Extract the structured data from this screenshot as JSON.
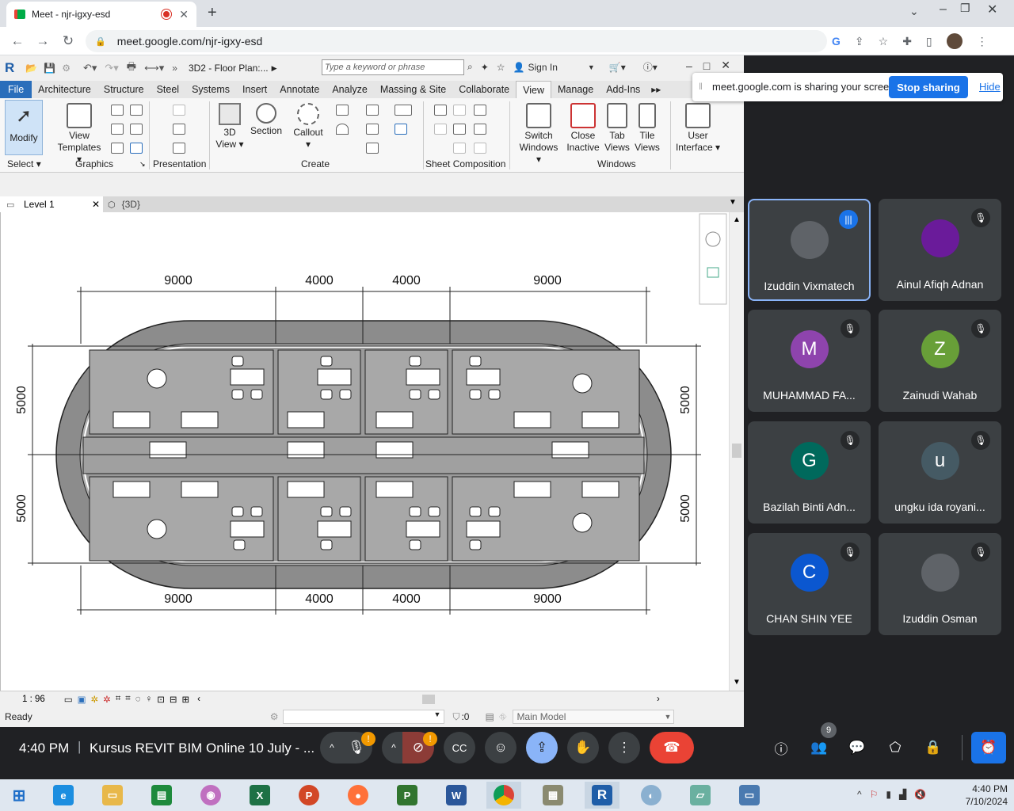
{
  "browser": {
    "tab_title": "Meet - njr-igxy-esd",
    "url": "meet.google.com/njr-igxy-esd"
  },
  "revit": {
    "title": "3D2 - Floor Plan:...",
    "search_placeholder": "Type a keyword or phrase",
    "sign_in": "Sign In",
    "tabs": [
      "File",
      "Architecture",
      "Structure",
      "Steel",
      "Systems",
      "Insert",
      "Annotate",
      "Analyze",
      "Massing & Site",
      "Collaborate",
      "View",
      "Manage",
      "Add-Ins"
    ],
    "active_tab": "View",
    "buttons": {
      "modify": "Modify",
      "view_templates_1": "View",
      "view_templates_2": "Templates",
      "view_3d_1": "3D",
      "view_3d_2": "View",
      "section": "Section",
      "callout": "Callout",
      "switch_windows_1": "Switch",
      "switch_windows_2": "Windows",
      "close_inactive_1": "Close",
      "close_inactive_2": "Inactive",
      "tab_views_1": "Tab",
      "tab_views_2": "Views",
      "tile_views_1": "Tile",
      "tile_views_2": "Views",
      "user_interface_1": "User",
      "user_interface_2": "Interface"
    },
    "groups": {
      "select": "Select",
      "graphics": "Graphics",
      "presentation": "Presentation",
      "create": "Create",
      "sheet_composition": "Sheet Composition",
      "windows": "Windows"
    },
    "view_tabs": [
      "Level 1",
      "{3D}"
    ],
    "scale": "1 : 96",
    "status": "Ready",
    "selection_count": ":0",
    "workset": "Main Model",
    "plan": {
      "top_dims": [
        "9000",
        "4000",
        "4000",
        "9000"
      ],
      "bottom_dims": [
        "9000",
        "4000",
        "4000",
        "9000"
      ],
      "left_dims": [
        "5000",
        "5000"
      ],
      "right_dims": [
        "5000",
        "5000"
      ]
    }
  },
  "share_banner": {
    "message": "meet.google.com is sharing your screen.",
    "stop": "Stop sharing",
    "hide": "Hide"
  },
  "participants": [
    {
      "name": "Izuddin Vixmatech",
      "initial": "",
      "color": "#5f6368",
      "speaking": true
    },
    {
      "name": "Ainul Afiqh Adnan",
      "initial": "",
      "color": "#6a1b9a",
      "speaking": false
    },
    {
      "name": "MUHAMMAD FA...",
      "initial": "M",
      "color": "#8e44ad",
      "speaking": false
    },
    {
      "name": "Zainudi Wahab",
      "initial": "Z",
      "color": "#689f38",
      "speaking": false
    },
    {
      "name": "Bazilah Binti Adn...",
      "initial": "G",
      "color": "#00695c",
      "speaking": false
    },
    {
      "name": "ungku ida royani...",
      "initial": "u",
      "color": "#455a64",
      "speaking": false
    },
    {
      "name": "CHAN SHIN YEE",
      "initial": "C",
      "color": "#0b57d0",
      "speaking": false
    },
    {
      "name": "Izuddin Osman",
      "initial": "",
      "color": "#5f6368",
      "speaking": false
    }
  ],
  "meeting": {
    "time": "4:40 PM",
    "title": "Kursus REVIT BIM Online 10 July - ...",
    "people_count": "9"
  },
  "taskbar": {
    "time": "4:40 PM",
    "date": "7/10/2024"
  }
}
